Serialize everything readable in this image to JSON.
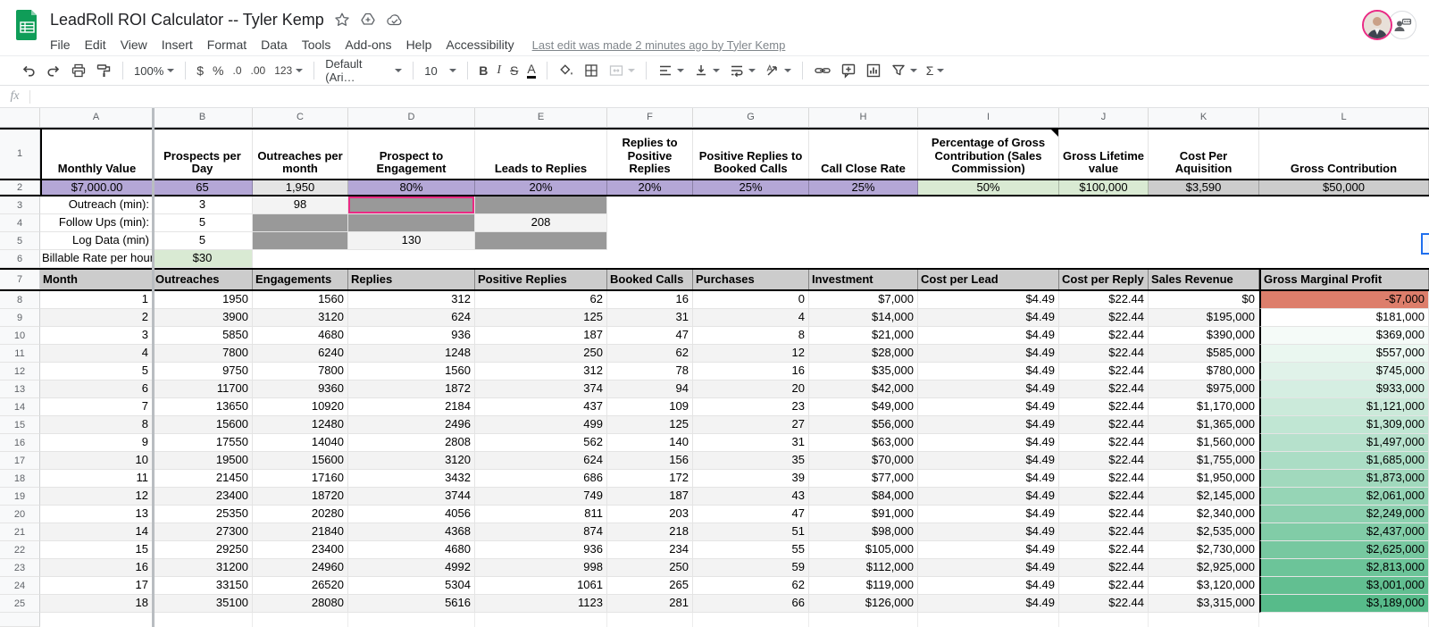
{
  "titlebar": {
    "title": "LeadRoll ROI Calculator -- Tyler Kemp",
    "menus": [
      "File",
      "Edit",
      "View",
      "Insert",
      "Format",
      "Data",
      "Tools",
      "Add-ons",
      "Help",
      "Accessibility"
    ],
    "last_edit": "Last edit was made 2 minutes ago by Tyler Kemp"
  },
  "toolbar": {
    "zoom": "100%",
    "currency": "$",
    "percent": "%",
    "decrease_decimal": ".0",
    "increase_decimal": ".00",
    "more_formats": "123",
    "font": "Default (Ari…",
    "font_size": "10",
    "bold": "B",
    "italic": "I",
    "strikethrough": "S",
    "text_color": "A",
    "functions": "Σ"
  },
  "formula_bar": {
    "fx_label": "fx",
    "value": ""
  },
  "grid": {
    "col_letters": [
      "A",
      "B",
      "C",
      "D",
      "E",
      "F",
      "G",
      "H",
      "I",
      "J",
      "K",
      "L"
    ],
    "visible_row_numbers": [
      "1",
      "2",
      "3",
      "4",
      "5",
      "6",
      "7",
      "8",
      "9",
      "10",
      "11",
      "12",
      "13",
      "14",
      "15",
      "16",
      "17",
      "18",
      "19",
      "20",
      "21",
      "22",
      "23",
      "24",
      "25"
    ]
  },
  "top_table": {
    "headers": [
      "Monthly Value",
      "Prospects per Day",
      "Outreaches per month",
      "Prospect to Engagement",
      "Leads to Replies",
      "Replies to Positive Replies",
      "Positive Replies to Booked Calls",
      "Call Close Rate",
      "Percentage of Gross Contribution (Sales Commission)",
      "Gross Lifetime value",
      "Cost Per Aquisition",
      "Gross Contribution"
    ],
    "values": [
      "$7,000.00",
      "65",
      "1,950",
      "80%",
      "20%",
      "20%",
      "25%",
      "25%",
      "50%",
      "$100,000",
      "$3,590",
      "$50,000"
    ]
  },
  "input_rows": [
    {
      "label": "Outreach (min):",
      "b": "3",
      "c": "98",
      "d": "",
      "e": ""
    },
    {
      "label": "Follow Ups (min):",
      "b": "5",
      "c": "",
      "d": "",
      "e": "208"
    },
    {
      "label": "Log Data (min)",
      "b": "5",
      "c": "",
      "d": "130",
      "e": ""
    },
    {
      "label": "Billable Rate per hour",
      "b": "$30"
    }
  ],
  "data_table": {
    "headers": [
      "Month",
      "Outreaches",
      "Engagements",
      "Replies",
      "Positive Replies",
      "Booked Calls",
      "Purchases",
      "Investment",
      "Cost per Lead",
      "Cost per Reply",
      "Sales Revenue",
      "Gross Marginal Profit"
    ],
    "rows": [
      [
        "1",
        "1950",
        "1560",
        "312",
        "62",
        "16",
        "0",
        "$7,000",
        "$4.49",
        "$22.44",
        "$0",
        "-$7,000"
      ],
      [
        "2",
        "3900",
        "3120",
        "624",
        "125",
        "31",
        "4",
        "$14,000",
        "$4.49",
        "$22.44",
        "$195,000",
        "$181,000"
      ],
      [
        "3",
        "5850",
        "4680",
        "936",
        "187",
        "47",
        "8",
        "$21,000",
        "$4.49",
        "$22.44",
        "$390,000",
        "$369,000"
      ],
      [
        "4",
        "7800",
        "6240",
        "1248",
        "250",
        "62",
        "12",
        "$28,000",
        "$4.49",
        "$22.44",
        "$585,000",
        "$557,000"
      ],
      [
        "5",
        "9750",
        "7800",
        "1560",
        "312",
        "78",
        "16",
        "$35,000",
        "$4.49",
        "$22.44",
        "$780,000",
        "$745,000"
      ],
      [
        "6",
        "11700",
        "9360",
        "1872",
        "374",
        "94",
        "20",
        "$42,000",
        "$4.49",
        "$22.44",
        "$975,000",
        "$933,000"
      ],
      [
        "7",
        "13650",
        "10920",
        "2184",
        "437",
        "109",
        "23",
        "$49,000",
        "$4.49",
        "$22.44",
        "$1,170,000",
        "$1,121,000"
      ],
      [
        "8",
        "15600",
        "12480",
        "2496",
        "499",
        "125",
        "27",
        "$56,000",
        "$4.49",
        "$22.44",
        "$1,365,000",
        "$1,309,000"
      ],
      [
        "9",
        "17550",
        "14040",
        "2808",
        "562",
        "140",
        "31",
        "$63,000",
        "$4.49",
        "$22.44",
        "$1,560,000",
        "$1,497,000"
      ],
      [
        "10",
        "19500",
        "15600",
        "3120",
        "624",
        "156",
        "35",
        "$70,000",
        "$4.49",
        "$22.44",
        "$1,755,000",
        "$1,685,000"
      ],
      [
        "11",
        "21450",
        "17160",
        "3432",
        "686",
        "172",
        "39",
        "$77,000",
        "$4.49",
        "$22.44",
        "$1,950,000",
        "$1,873,000"
      ],
      [
        "12",
        "23400",
        "18720",
        "3744",
        "749",
        "187",
        "43",
        "$84,000",
        "$4.49",
        "$22.44",
        "$2,145,000",
        "$2,061,000"
      ],
      [
        "13",
        "25350",
        "20280",
        "4056",
        "811",
        "203",
        "47",
        "$91,000",
        "$4.49",
        "$22.44",
        "$2,340,000",
        "$2,249,000"
      ],
      [
        "14",
        "27300",
        "21840",
        "4368",
        "874",
        "218",
        "51",
        "$98,000",
        "$4.49",
        "$22.44",
        "$2,535,000",
        "$2,437,000"
      ],
      [
        "15",
        "29250",
        "23400",
        "4680",
        "936",
        "234",
        "55",
        "$105,000",
        "$4.49",
        "$22.44",
        "$2,730,000",
        "$2,625,000"
      ],
      [
        "16",
        "31200",
        "24960",
        "4992",
        "998",
        "250",
        "59",
        "$112,000",
        "$4.49",
        "$22.44",
        "$2,925,000",
        "$2,813,000"
      ],
      [
        "17",
        "33150",
        "26520",
        "5304",
        "1061",
        "265",
        "62",
        "$119,000",
        "$4.49",
        "$22.44",
        "$3,120,000",
        "$3,001,000"
      ],
      [
        "18",
        "35100",
        "28080",
        "5616",
        "1123",
        "281",
        "66",
        "$126,000",
        "$4.49",
        "$22.44",
        "$3,315,000",
        "$3,189,000"
      ]
    ]
  },
  "colors": {
    "accent_purple": "#b4a7d6",
    "accent_green": "#d9ead3",
    "accent_gray": "#cccccc",
    "input_dark_gray": "#999999",
    "input_light_gray": "#f3f3f3",
    "profit_negative": "#dd7e6b",
    "profit_max_green": "#57bb8a",
    "collaborator_pink": "#ea2a84",
    "collaborator_blue": "#1f6fee",
    "logo_green": "#0f9d58"
  },
  "profit_scale": {
    "white_at": 181000,
    "max_at": 3189000
  }
}
